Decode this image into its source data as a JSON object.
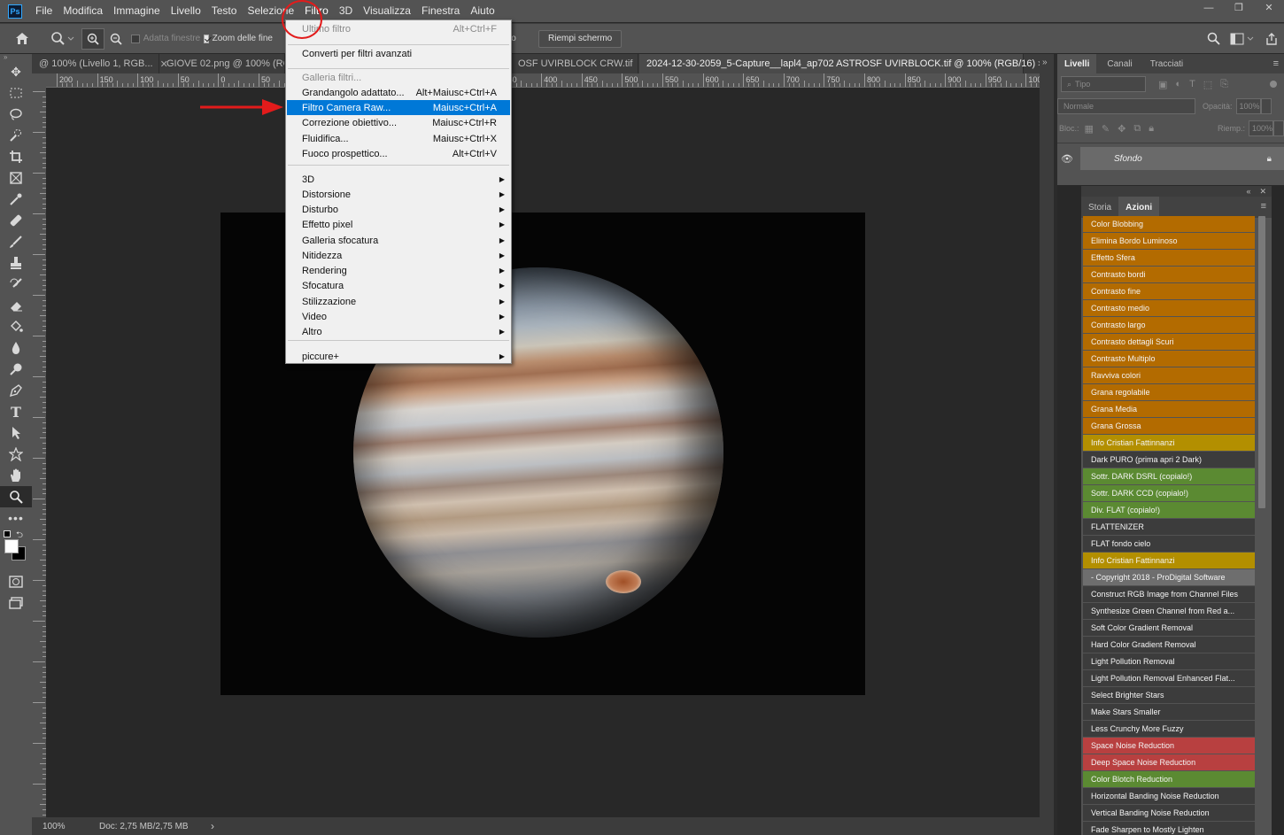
{
  "app": {
    "logo": "Ps"
  },
  "menubar": {
    "items": [
      "File",
      "Modifica",
      "Immagine",
      "Livello",
      "Testo",
      "Selezione",
      "Filtro",
      "3D",
      "Visualizza",
      "Finestra",
      "Aiuto"
    ]
  },
  "window_controls": {
    "minimize": "—",
    "restore": "❐",
    "close": "✕"
  },
  "options_bar": {
    "fit_windows_label": "Adatta finestre",
    "zoom_all_label": "Zoom delle fine",
    "fill_screen_label": "Riempi schermo",
    "screen_label_partial": "ermo"
  },
  "tabs": [
    {
      "label": "@ 100% (Livello 1, RGB...",
      "close": "✕"
    },
    {
      "label": "GIOVE 02.png @ 100% (RGB...",
      "close": ""
    },
    {
      "label": "OSF UVIRBLOCK CRW.tif",
      "close": "✕"
    },
    {
      "label": "2024-12-30-2059_5-Capture__lapl4_ap702 ASTROSF UVIRBLOCK.tif @ 100% (RGB/16)",
      "close": "✕"
    }
  ],
  "tabs_overflow": "»",
  "ruler": {
    "h_labels": [
      "200",
      "150",
      "100",
      "50",
      "0",
      "50",
      "100",
      "150",
      "200",
      "250",
      "300",
      "350",
      "400",
      "450",
      "500",
      "550",
      "600",
      "650",
      "700",
      "750",
      "800",
      "850",
      "900",
      "950",
      "100"
    ]
  },
  "status": {
    "zoom": "100%",
    "doc": "Doc: 2,75 MB/2,75 MB",
    "arrow": "›"
  },
  "filter_menu": {
    "items": [
      {
        "label": "Ultimo filtro",
        "shortcut": "Alt+Ctrl+F",
        "disabled": true
      },
      {
        "label": "Converti per filtri avanzati",
        "shortcut": ""
      },
      {
        "label": "Galleria filtri...",
        "shortcut": "",
        "disabled": true
      },
      {
        "label": "Grandangolo adattato...",
        "shortcut": "Alt+Maiusc+Ctrl+A"
      },
      {
        "label": "Filtro Camera Raw...",
        "shortcut": "Maiusc+Ctrl+A",
        "highlighted": true
      },
      {
        "label": "Correzione obiettivo...",
        "shortcut": "Maiusc+Ctrl+R"
      },
      {
        "label": "Fluidifica...",
        "shortcut": "Maiusc+Ctrl+X"
      },
      {
        "label": "Fuoco prospettico...",
        "shortcut": "Alt+Ctrl+V"
      },
      {
        "label": "3D"
      },
      {
        "label": "Distorsione"
      },
      {
        "label": "Disturbo"
      },
      {
        "label": "Effetto pixel"
      },
      {
        "label": "Galleria sfocatura"
      },
      {
        "label": "Nitidezza"
      },
      {
        "label": "Rendering"
      },
      {
        "label": "Sfocatura"
      },
      {
        "label": "Stilizzazione"
      },
      {
        "label": "Video"
      },
      {
        "label": "Altro"
      },
      {
        "label": "piccure+"
      }
    ]
  },
  "layers_panel": {
    "tabs": [
      "Livelli",
      "Canali",
      "Tracciati"
    ],
    "kind_placeholder": "Tipo",
    "blend_mode": "Normale",
    "opacity_label": "Opacità:",
    "opacity_value": "100%",
    "lock_label": "Bloc.:",
    "fill_label": "Riemp.:",
    "fill_value": "100%",
    "layer_name": "Sfondo"
  },
  "actions_panel": {
    "tabs": [
      "Storia",
      "Azioni"
    ],
    "items": [
      {
        "label": "Color Blobbing",
        "color": "#b36b00"
      },
      {
        "label": "Elimina Bordo Luminoso",
        "color": "#b36b00"
      },
      {
        "label": "Effetto Sfera",
        "color": "#b36b00"
      },
      {
        "label": "Contrasto bordi",
        "color": "#b36b00"
      },
      {
        "label": "Contrasto fine",
        "color": "#b36b00"
      },
      {
        "label": "Contrasto medio",
        "color": "#b36b00"
      },
      {
        "label": "Contrasto largo",
        "color": "#b36b00"
      },
      {
        "label": "Contrasto dettagli Scuri",
        "color": "#b36b00"
      },
      {
        "label": "Contrasto Multiplo",
        "color": "#b36b00"
      },
      {
        "label": "Ravviva colori",
        "color": "#b36b00"
      },
      {
        "label": "Grana regolabile",
        "color": "#b36b00"
      },
      {
        "label": "Grana Media",
        "color": "#b36b00"
      },
      {
        "label": "Grana Grossa",
        "color": "#b36b00"
      },
      {
        "label": "Info Cristian Fattinnanzi",
        "color": "#b38f00"
      },
      {
        "label": "Dark PURO (prima apri 2 Dark)",
        "color": "#3c3c3c"
      },
      {
        "label": "Sottr. DARK DSRL (copialo!)",
        "color": "#5b8a32"
      },
      {
        "label": "Sottr. DARK CCD (copialo!)",
        "color": "#5b8a32"
      },
      {
        "label": "Div. FLAT (copialo!)",
        "color": "#5b8a32"
      },
      {
        "label": "FLATTENIZER",
        "color": "#3c3c3c"
      },
      {
        "label": "FLAT fondo cielo",
        "color": "#3c3c3c"
      },
      {
        "label": "Info Cristian Fattinnanzi",
        "color": "#b38f00"
      },
      {
        "label": "- Copyright 2018 - ProDigital Software",
        "color": "#6e6e6e"
      },
      {
        "label": "Construct RGB Image from Channel Files",
        "color": "#3c3c3c"
      },
      {
        "label": "Synthesize Green Channel from Red a...",
        "color": "#3c3c3c"
      },
      {
        "label": "Soft Color Gradient Removal",
        "color": "#3c3c3c"
      },
      {
        "label": "Hard Color Gradient Removal",
        "color": "#3c3c3c"
      },
      {
        "label": "Light Pollution Removal",
        "color": "#3c3c3c"
      },
      {
        "label": "Light Pollution Removal Enhanced Flat...",
        "color": "#3c3c3c"
      },
      {
        "label": "Select Brighter Stars",
        "color": "#3c3c3c"
      },
      {
        "label": "Make Stars Smaller",
        "color": "#3c3c3c"
      },
      {
        "label": "Less Crunchy More Fuzzy",
        "color": "#3c3c3c"
      },
      {
        "label": "Space Noise Reduction",
        "color": "#b84040"
      },
      {
        "label": "Deep Space Noise Reduction",
        "color": "#b84040"
      },
      {
        "label": "Color Blotch Reduction",
        "color": "#5b8a32"
      },
      {
        "label": "Horizontal Banding Noise Reduction",
        "color": "#3c3c3c"
      },
      {
        "label": "Vertical Banding Noise Reduction",
        "color": "#3c3c3c"
      },
      {
        "label": "Fade Sharpen to Mostly Lighten",
        "color": "#3c3c3c"
      }
    ]
  },
  "annotation_colors": {
    "circle": "#e21b1b",
    "arrow": "#e21b1b"
  }
}
